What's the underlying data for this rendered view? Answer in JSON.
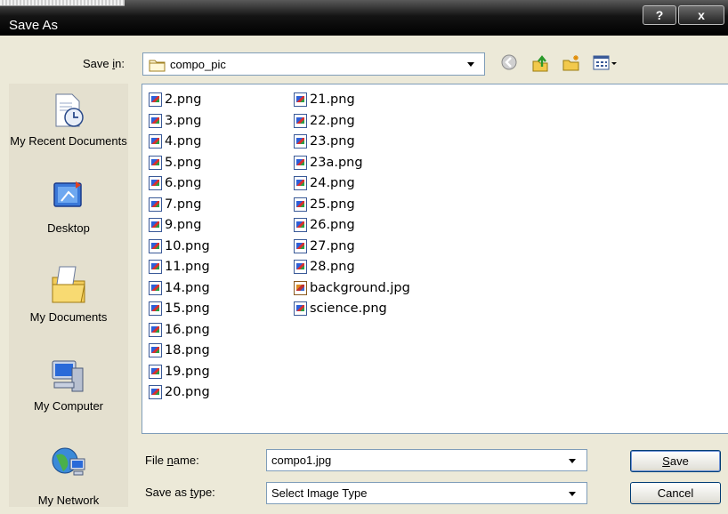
{
  "window": {
    "title": "Save As",
    "help_label": "?",
    "close_label": "x"
  },
  "save_in": {
    "label_pre": "Save ",
    "label_accel": "i",
    "label_post": "n:",
    "value": "compo_pic"
  },
  "places": [
    {
      "label": "My Recent Documents",
      "icon": "recent-documents-icon"
    },
    {
      "label": "Desktop",
      "icon": "desktop-icon"
    },
    {
      "label": "My Documents",
      "icon": "my-documents-icon"
    },
    {
      "label": "My Computer",
      "icon": "my-computer-icon"
    },
    {
      "label": "My Network",
      "icon": "my-network-icon"
    }
  ],
  "files": {
    "col1": [
      "2.png",
      "3.png",
      "4.png",
      "5.png",
      "6.png",
      "7.png",
      "9.png",
      "10.png",
      "11.png",
      "14.png",
      "15.png",
      "16.png",
      "18.png",
      "19.png",
      "20.png"
    ],
    "col2": [
      "21.png",
      "22.png",
      "23.png",
      "23a.png",
      "24.png",
      "25.png",
      "26.png",
      "27.png",
      "28.png",
      "background.jpg",
      "science.png"
    ]
  },
  "file_name": {
    "label_pre": "File ",
    "label_accel": "n",
    "label_post": "ame:",
    "value": "compo1.jpg"
  },
  "save_as_type": {
    "label_pre": "Save as ",
    "label_accel": "t",
    "label_post": "ype:",
    "value": "Select Image Type"
  },
  "buttons": {
    "save_accel": "S",
    "save_rest": "ave",
    "cancel": "Cancel"
  }
}
